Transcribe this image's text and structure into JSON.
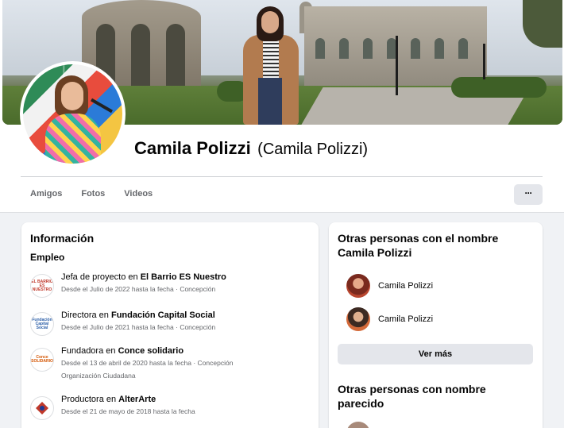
{
  "profile": {
    "name": "Camila Polizzi",
    "alt_name": "(Camila Polizzi)"
  },
  "tabs": [
    {
      "label": "Amigos"
    },
    {
      "label": "Fotos"
    },
    {
      "label": "Videos"
    }
  ],
  "more_button": {
    "label": "···"
  },
  "info": {
    "title": "Información",
    "section": "Empleo",
    "jobs": [
      {
        "role": "Jefa de proyecto en ",
        "org": "El Barrio ES Nuestro",
        "meta": "Desde el Julio de 2022 hasta la fecha · Concepción",
        "meta2": "",
        "logo": "EL BARRIO ES NUESTRO"
      },
      {
        "role": "Directora en ",
        "org": "Fundación Capital Social",
        "meta": "Desde el Julio de 2021 hasta la fecha · Concepción",
        "meta2": "",
        "logo": "Fundación Capital Social"
      },
      {
        "role": "Fundadora en ",
        "org": "Conce solidario",
        "meta": "Desde el 13 de abril de 2020 hasta la fecha · Concepción",
        "meta2": "Organización Ciudadana",
        "logo": "Conce SOLIDARIO"
      },
      {
        "role": "Productora en ",
        "org": "AlterArte",
        "meta": "Desde el 21 de mayo de 2018 hasta la fecha",
        "meta2": "",
        "logo": ""
      }
    ]
  },
  "side": {
    "title": "Otras personas con el nombre Camila Polizzi",
    "people": [
      {
        "name": "Camila Polizzi"
      },
      {
        "name": "Camila Polizzi"
      }
    ],
    "see_more": "Ver más",
    "similar_title": "Otras personas con nombre parecido"
  },
  "colors": {
    "background": "#f0f2f5",
    "card": "#ffffff",
    "secondary_text": "#65676b",
    "button_gray": "#e4e6eb"
  }
}
